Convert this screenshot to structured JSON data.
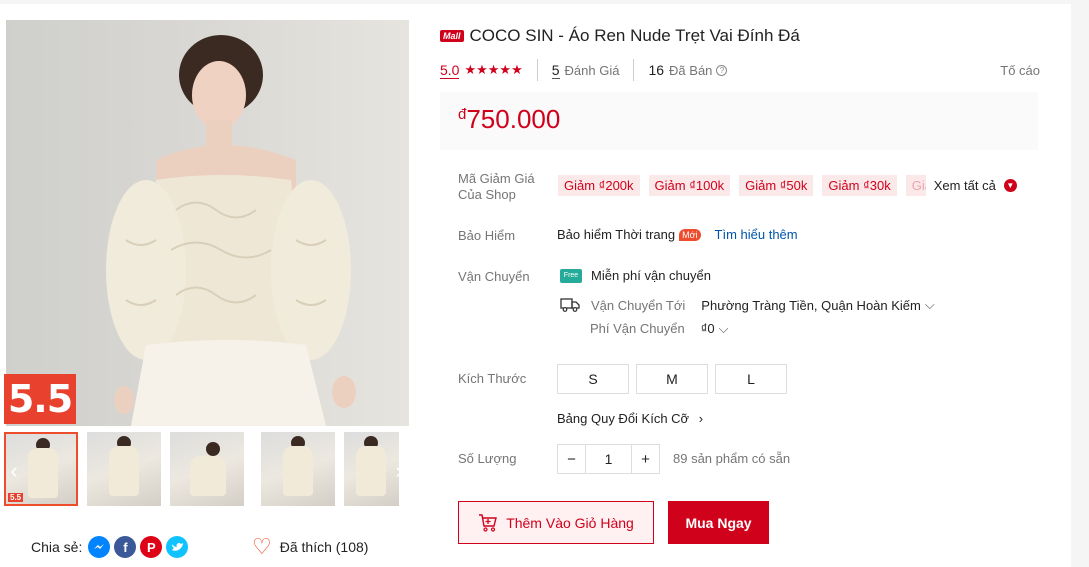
{
  "gallery": {
    "sale_badge": "5.5",
    "thumb_badge": "5.5",
    "thumbs": [
      "thumb-1",
      "thumb-2",
      "thumb-3",
      "thumb-4",
      "thumb-5"
    ]
  },
  "share": {
    "label": "Chia sẻ:",
    "networks": [
      "messenger-icon",
      "facebook-icon",
      "pinterest-icon",
      "twitter-icon"
    ]
  },
  "favorite": {
    "label": "Đã thích (108)"
  },
  "product": {
    "mall_badge": "Mall",
    "title": "COCO SIN - Áo Ren Nude Trẹt Vai Đính Đá",
    "rating": "5.0",
    "stars": "★★★★★",
    "reviews_count": "5",
    "reviews_label": "Đánh Giá",
    "sold_count": "16",
    "sold_label": "Đã Bán",
    "report": "Tố cáo",
    "currency": "đ",
    "price": "750.000"
  },
  "vouchers": {
    "label_line1": "Mã Giảm Giá",
    "label_line2": "Của Shop",
    "items": [
      "Giảm ₫200k",
      "Giảm ₫100k",
      "Giảm ₫50k",
      "Giảm ₫30k",
      "Giả"
    ],
    "see_all": "Xem tất cả"
  },
  "insurance": {
    "label": "Bảo Hiểm",
    "name": "Bảo hiểm Thời trang",
    "badge": "Mới",
    "link": "Tìm hiểu thêm"
  },
  "shipping": {
    "label": "Vận Chuyển",
    "free_icon": "Free",
    "free_text": "Miễn phí vận chuyển",
    "to_label": "Vận Chuyển Tới",
    "to_value": "Phường Tràng Tiền, Quận Hoàn Kiếm",
    "fee_label": "Phí Vận Chuyển",
    "fee_value": "₫0"
  },
  "size": {
    "label": "Kích Thước",
    "options": [
      "S",
      "M",
      "L"
    ],
    "chart_link": "Bảng Quy Đổi Kích Cỡ"
  },
  "quantity": {
    "label": "Số Lượng",
    "minus": "−",
    "value": "1",
    "plus": "+",
    "available": "89 sản phẩm có sẵn"
  },
  "actions": {
    "add_to_cart": "Thêm Vào Giỏ Hàng",
    "buy_now": "Mua Ngay"
  },
  "colors": {
    "brand": "#d0011b",
    "accent": "#ee4d2d",
    "voucher_bg": "#fbe9ea"
  }
}
